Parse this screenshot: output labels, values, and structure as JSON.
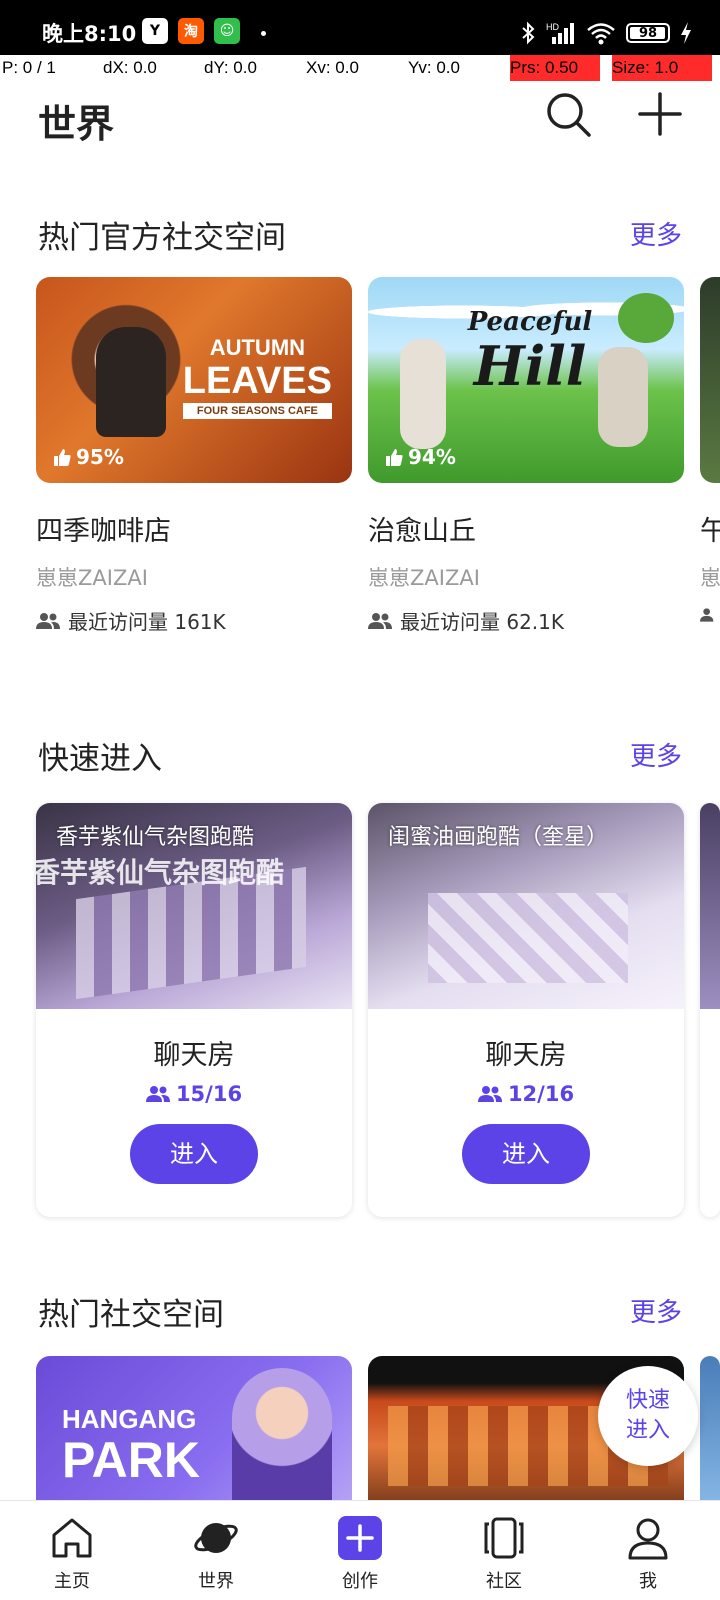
{
  "status_bar": {
    "time": "晚上8:10",
    "network_label": "HD",
    "battery_level": 98,
    "battery_text": "98",
    "notification_icons": [
      "y-app-icon",
      "taobao-icon",
      "wechat-icon"
    ]
  },
  "debug_overlay": {
    "p": "P: 0 / 1",
    "dx": "dX: 0.0",
    "dy": "dY: 0.0",
    "xv": "Xv: 0.0",
    "yv": "Yv: 0.0",
    "prs": "Prs: 0.50",
    "size": "Size: 1.0"
  },
  "header": {
    "title": "世界",
    "search_icon": "search-icon",
    "add_icon": "plus-icon"
  },
  "official_spaces": {
    "title": "热门官方社交空间",
    "more": "更多",
    "cards": [
      {
        "name": "四季咖啡店",
        "author": "崽崽ZAIZAI",
        "visits": "最近访问量 161K",
        "like_pct": "95%",
        "banner_line1": "AUTUMN",
        "banner_line2": "LEAVES",
        "banner_sub": "FOUR SEASONS CAFE"
      },
      {
        "name": "治愈山丘",
        "author": "崽崽ZAIZAI",
        "visits": "最近访问量 62.1K",
        "like_pct": "94%",
        "banner_line1": "Peaceful",
        "banner_line2": "Hill"
      },
      {
        "name": "午",
        "author": "崽",
        "visits": ""
      }
    ]
  },
  "quick_enter": {
    "title": "快速进入",
    "more": "更多",
    "cards": [
      {
        "image_title": "香芋紫仙气杂图跑酷",
        "image_overlay": "香芋紫仙气杂图跑酷",
        "type": "聊天房",
        "count": "15/16",
        "button": "进入"
      },
      {
        "image_title": "闺蜜油画跑酷（奎星）",
        "type": "聊天房",
        "count": "12/16",
        "button": "进入"
      }
    ]
  },
  "popular_spaces": {
    "title": "热门社交空间",
    "more": "更多",
    "cards": [
      {
        "banner_line1": "HANGANG",
        "banner_line2": "PARK"
      },
      {
        "banner_text": ""
      }
    ]
  },
  "fab": {
    "line1": "快速",
    "line2": "进入"
  },
  "bottom_nav": {
    "items": [
      {
        "label": "主页",
        "icon": "home-icon"
      },
      {
        "label": "世界",
        "icon": "planet-icon"
      },
      {
        "label": "创作",
        "icon": "create-plus-icon"
      },
      {
        "label": "社区",
        "icon": "community-icon"
      },
      {
        "label": "我",
        "icon": "profile-icon"
      }
    ]
  },
  "colors": {
    "accent": "#5b43e8",
    "text": "#222222",
    "muted": "#9a9a9a",
    "debug_red": "#ff2b2b"
  }
}
